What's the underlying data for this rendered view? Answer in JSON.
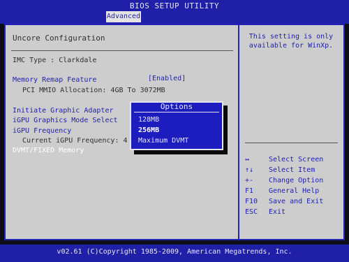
{
  "header": {
    "title": "BIOS SETUP UTILITY",
    "active_tab": "Advanced"
  },
  "main": {
    "section_title": "Uncore Configuration",
    "imc_type": "IMC Type : Clarkdale",
    "memory_remap_label": "Memory Remap Feature",
    "memory_remap_value": "[Enabled]",
    "pci_mmio": "PCI MMIO Allocation: 4GB To 3072MB",
    "initiate_graphic_adapter": "Initiate Graphic Adapter",
    "igpu_graphics_mode": "iGPU Graphics Mode Select",
    "igpu_frequency": "iGPU Frequency",
    "current_igpu_frequency": "Current iGPU Frequency: 4",
    "dvmt_fixed_memory": "DVMT/FIXED Memory"
  },
  "popup": {
    "title": "Options",
    "options": [
      "128MB",
      "256MB",
      "Maximum DVMT"
    ],
    "selected": "256MB"
  },
  "help": {
    "text": "This setting is only available for WinXp.",
    "keys": [
      {
        "key": "↔",
        "desc": "Select Screen"
      },
      {
        "key": "↑↓",
        "desc": "Select Item"
      },
      {
        "key": "+-",
        "desc": "Change Option"
      },
      {
        "key": "F1",
        "desc": "General Help"
      },
      {
        "key": "F10",
        "desc": "Save and Exit"
      },
      {
        "key": "ESC",
        "desc": "Exit"
      }
    ]
  },
  "footer": {
    "copyright": "v02.61 (C)Copyright 1985-2009, American Megatrends, Inc."
  }
}
